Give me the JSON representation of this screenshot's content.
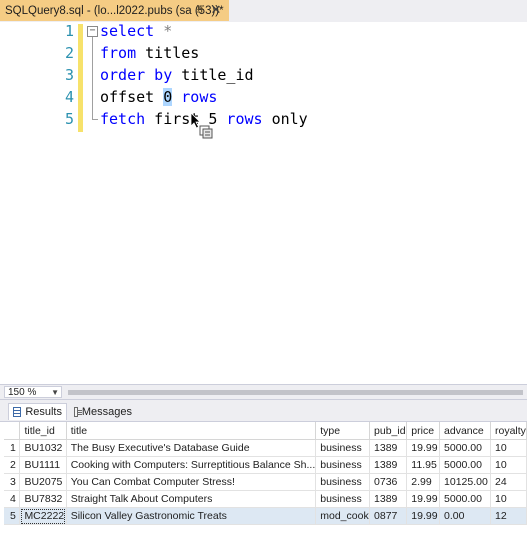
{
  "tab": {
    "title": "SQLQuery8.sql - (lo...l2022.pubs (sa (53))*",
    "pin_icon": "pin-icon",
    "close_icon": "close-icon"
  },
  "editor": {
    "line_numbers": [
      "1",
      "2",
      "3",
      "4",
      "5"
    ],
    "lines": {
      "l1": {
        "kw": "select",
        "rest": " *"
      },
      "l2": {
        "kw": "from",
        "rest": " titles"
      },
      "l3": {
        "kw": "order by",
        "rest": " title_id"
      },
      "l4": {
        "plain": "offset ",
        "sel": "0",
        "kw": " rows"
      },
      "l5": {
        "kw1": "fetch",
        "mid": " firs",
        "mid2": "t 5",
        "kw2": " rows",
        "rest": " only"
      }
    },
    "colors": {
      "keyword": "#0000ff",
      "line_number": "#2b91af",
      "selection": "#add6ff"
    }
  },
  "zoom": {
    "value": "150 %"
  },
  "results_tabs": {
    "results_label": "Results",
    "messages_label": "Messages"
  },
  "grid": {
    "columns": [
      "",
      "title_id",
      "title",
      "type",
      "pub_id",
      "price",
      "advance",
      "royalty"
    ],
    "rows": [
      [
        "1",
        "BU1032",
        "The Busy Executive's Database Guide",
        "business",
        "1389",
        "19.99",
        "5000.00",
        "10"
      ],
      [
        "2",
        "BU1111",
        "Cooking with Computers: Surreptitious Balance Sh...",
        "business",
        "1389",
        "11.95",
        "5000.00",
        "10"
      ],
      [
        "3",
        "BU2075",
        "You Can Combat Computer Stress!",
        "business",
        "0736",
        "2.99",
        "10125.00",
        "24"
      ],
      [
        "4",
        "BU7832",
        "Straight Talk About Computers",
        "business",
        "1389",
        "19.99",
        "5000.00",
        "10"
      ],
      [
        "5",
        "MC2222",
        "Silicon Valley Gastronomic Treats",
        "mod_cook",
        "0877",
        "19.99",
        "0.00",
        "12"
      ]
    ]
  }
}
